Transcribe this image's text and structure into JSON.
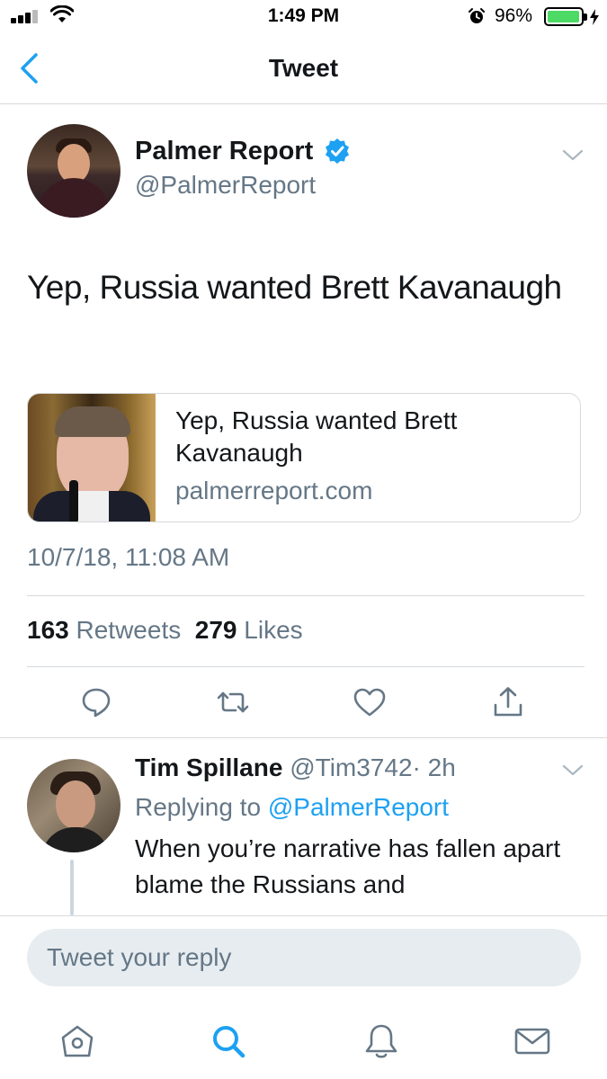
{
  "status_bar": {
    "time": "1:49 PM",
    "battery_percent": "96%",
    "battery_level": 0.96,
    "icons": [
      "signal-icon",
      "wifi-icon",
      "alarm-icon",
      "battery-icon",
      "charging-icon"
    ]
  },
  "nav": {
    "title": "Tweet",
    "back_icon": "chevron-left-icon"
  },
  "tweet": {
    "author_name": "Palmer Report",
    "author_handle": "@PalmerReport",
    "verified": true,
    "text": "Yep, Russia wanted Brett Kavanaugh",
    "card": {
      "title": "Yep, Russia wanted Brett Kavanaugh",
      "domain": "palmerreport.com"
    },
    "timestamp": "10/7/18, 11:08 AM",
    "retweets_count": "163",
    "retweets_label": "Retweets",
    "likes_count": "279",
    "likes_label": "Likes"
  },
  "actions": [
    "reply-icon",
    "retweet-icon",
    "like-icon",
    "share-icon"
  ],
  "reply": {
    "name": "Tim Spillane",
    "handle": "@Tim3742",
    "age": "· 2h",
    "replying_prefix": "Replying to",
    "replying_handle": "@PalmerReport",
    "text": "When you’re narrative has fallen apart blame the Russians and"
  },
  "compose": {
    "placeholder": "Tweet your reply"
  },
  "tabbar": [
    "home-icon",
    "search-icon",
    "notifications-icon",
    "messages-icon"
  ],
  "colors": {
    "accent": "#1da1f2",
    "secondary_text": "#657786",
    "divider": "#d6d9dc",
    "battery": "#4cd964"
  }
}
